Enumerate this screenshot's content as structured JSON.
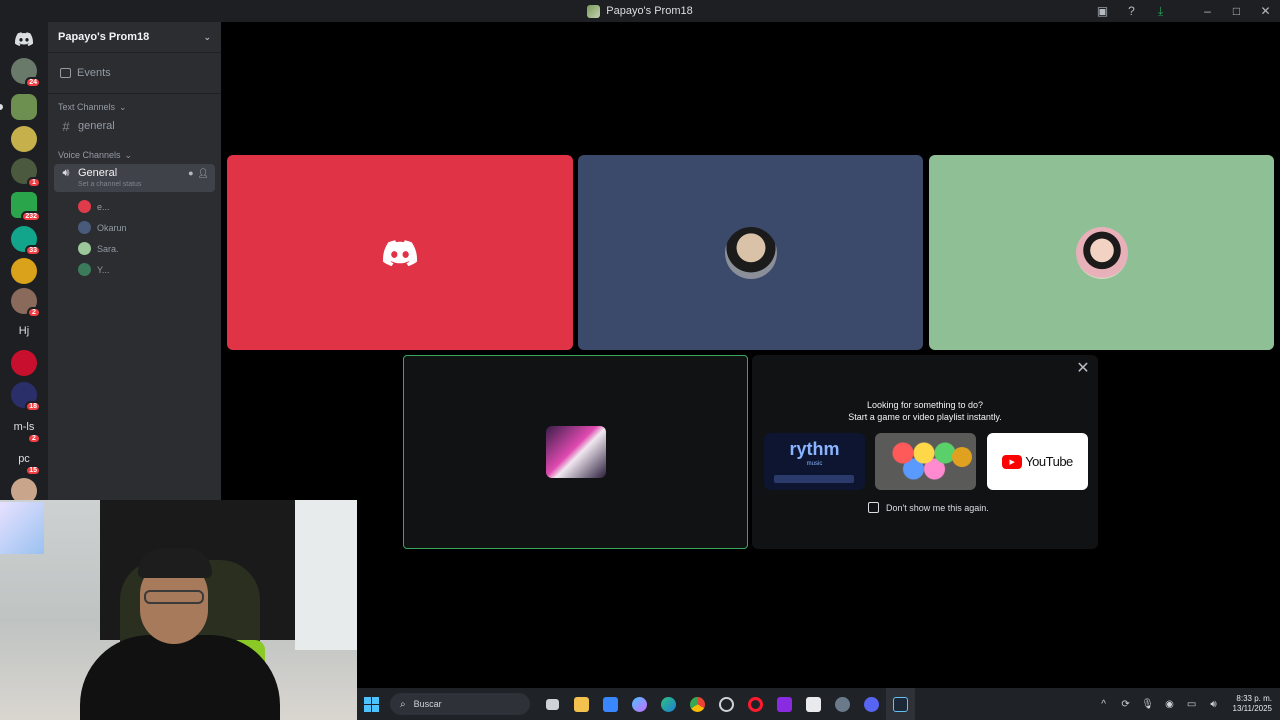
{
  "window": {
    "title": "Papayo's Prom18"
  },
  "rail": {
    "servers": [
      {
        "badge": "24"
      },
      {
        "badge": ""
      },
      {
        "badge": ""
      },
      {
        "badge": "1"
      },
      {
        "badge": "232"
      },
      {
        "badge": "33"
      },
      {
        "badge": ""
      },
      {
        "badge": "2"
      },
      {
        "label": "Hj",
        "badge": ""
      },
      {
        "badge": ""
      },
      {
        "badge": "18"
      },
      {
        "label": "m-ls",
        "badge": "2"
      },
      {
        "label": "pc",
        "badge": "15"
      },
      {
        "badge": ""
      }
    ]
  },
  "sidebar": {
    "guild_name": "Papayo's Prom18",
    "events_label": "Events",
    "text_category": "Text Channels",
    "text_channel": "general",
    "voice_category": "Voice Channels",
    "voice_channel": "General",
    "voice_status": "Set a channel status",
    "voice_users": [
      {
        "name": "e...",
        "color": "#e03b4b"
      },
      {
        "name": "Okarun",
        "color": "#4a5a7a"
      },
      {
        "name": "Sara.",
        "color": "#9cc79a"
      },
      {
        "name": "Y...",
        "color": "#3b7a5a"
      }
    ]
  },
  "stage": {
    "tiles": [
      {
        "color": "#e03345"
      },
      {
        "color": "#3b4a6b"
      },
      {
        "color": "#8fbf94"
      }
    ]
  },
  "activities": {
    "line1": "Looking for something to do?",
    "line2": "Start a game or video playlist instantly.",
    "card_rythm": "rythm",
    "card_rythm_sub": "music",
    "card_youtube": "YouTube",
    "dont_show": "Don't show me this again."
  },
  "taskbar": {
    "search_placeholder": "Buscar",
    "time": "8:33 p. m.",
    "date": "13/11/2025"
  },
  "colors": {
    "discord_blurple": "#5865f2",
    "sidebar_bg": "#2b2d31",
    "rail_bg": "#1e1f22",
    "stream_border": "#3ba55c",
    "badge_red": "#f23f43"
  }
}
